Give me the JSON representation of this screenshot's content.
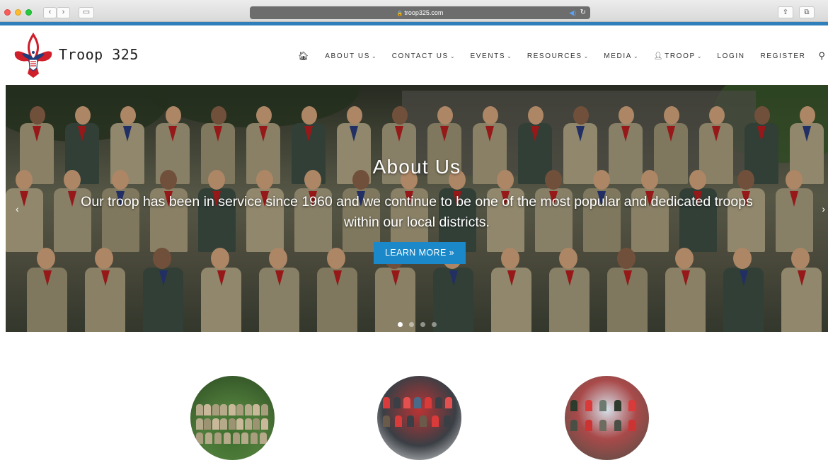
{
  "browser": {
    "url": "troop325.com"
  },
  "site": {
    "title": "Troop 325",
    "logo": "bsa-fleur-de-lis-logo"
  },
  "nav": {
    "items": [
      {
        "label": "ABOUT US",
        "dropdown": true
      },
      {
        "label": "CONTACT US",
        "dropdown": true
      },
      {
        "label": "EVENTS",
        "dropdown": true
      },
      {
        "label": "RESOURCES",
        "dropdown": true
      },
      {
        "label": "MEDIA",
        "dropdown": true
      },
      {
        "label": "TROOP",
        "dropdown": true,
        "icon": "user-icon"
      },
      {
        "label": "LOGIN",
        "dropdown": false
      },
      {
        "label": "REGISTER",
        "dropdown": false
      }
    ]
  },
  "hero": {
    "title": "About Us",
    "subtitle": "Our troop has been in service since 1960 and we continue to be one of the most popular and dedicated troops within our local districts.",
    "button": "LEARN MORE »",
    "slide_count": 4,
    "active_slide": 1
  },
  "colors": {
    "accent": "#1a88c9",
    "top_strip": "#2f7fbb"
  }
}
